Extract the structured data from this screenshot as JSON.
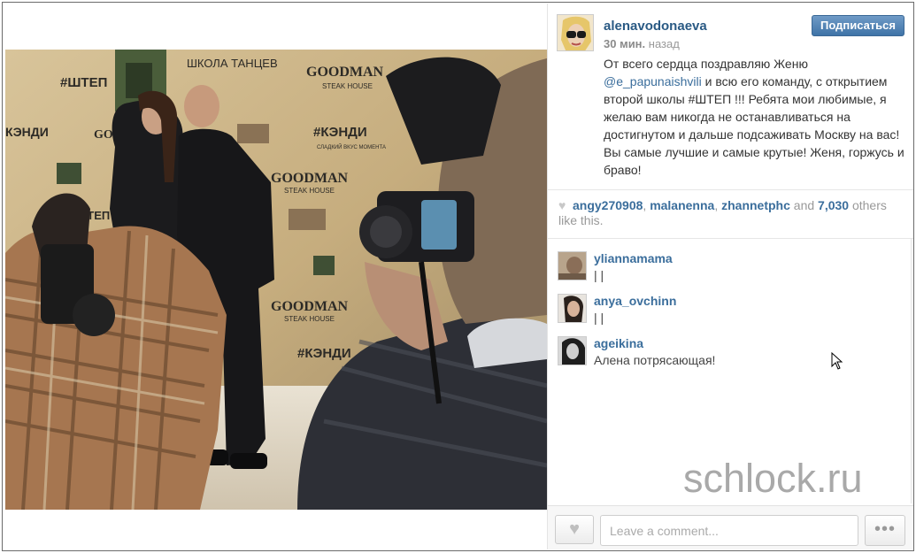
{
  "post": {
    "username": "alenavodonaeva",
    "time_value": "30 мин.",
    "time_suffix": "назад",
    "follow_label": "Подписаться",
    "caption_part1": "От всего сердца поздравляю Женю",
    "caption_mention": "@e_papunaishvili",
    "caption_part2": "и всю его команду, с открытием второй школы #ШТЕП !!! Ребята мои любимые, я желаю вам никогда не останавливаться на достигнутом и дальше подсаживать Москву на вас! Вы самые лучшие и самые крутые! Женя, горжусь и браво!"
  },
  "likes": {
    "users": [
      "angy270908",
      "malanenna",
      "zhannetphc"
    ],
    "sep1": ", ",
    "sep2": ", ",
    "and_text": "and",
    "count": "7,030",
    "suffix": "others like this."
  },
  "comments": [
    {
      "user": "yliannamama",
      "text": "| |"
    },
    {
      "user": "anya_ovchinn",
      "text": "| |"
    },
    {
      "user": "ageikina",
      "text": "Алена потрясающая!"
    }
  ],
  "footer": {
    "comment_placeholder": "Leave a comment...",
    "more_label": "•••",
    "like_icon": "♥"
  },
  "photo": {
    "backdrop_texts": [
      "ШКОЛА ТАНЦЕВ",
      "GOODMAN",
      "STEAK HOUSE",
      "#ШТЕП",
      "#КЭНДИ",
      "КЭНДИ",
      "СЛАДКИЙ ВКУС МОМЕНТА"
    ]
  },
  "watermark": "schlock.ru",
  "colors": {
    "link": "#3b6e9c",
    "follow_button": "#4a7eb3",
    "muted": "#999999"
  }
}
